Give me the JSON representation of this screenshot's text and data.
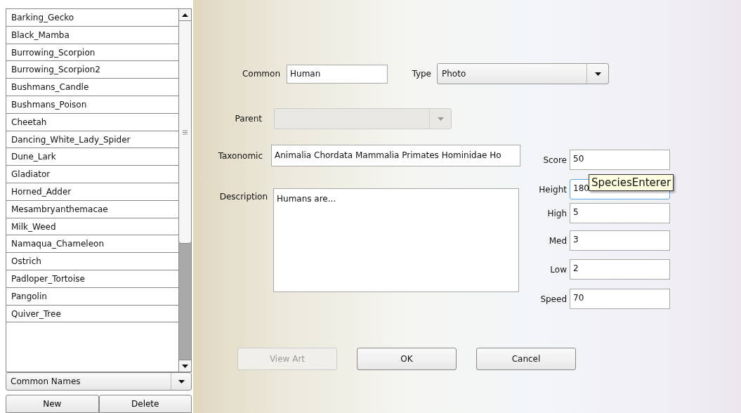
{
  "species_list": {
    "items": [
      "Barking_Gecko",
      "Black_Mamba",
      "Burrowing_Scorpion",
      "Burrowing_Scorpion2",
      "Bushmans_Candle",
      "Bushmans_Poison",
      "Cheetah",
      "Dancing_White_Lady_Spider",
      "Dune_Lark",
      "Gladiator",
      "Horned_Adder",
      "Mesambryanthemacae",
      "Milk_Weed",
      "Namaqua_Chameleon",
      "Ostrich",
      "Padloper_Tortoise",
      "Pangolin",
      "Quiver_Tree"
    ],
    "name_filter": "Common Names",
    "buttons": [
      "New",
      "Delete"
    ]
  },
  "form": {
    "common": {
      "label": "Common",
      "value": "Human"
    },
    "type": {
      "label": "Type",
      "value": "Photo"
    },
    "parent": {
      "label": "Parent",
      "disabled": true
    },
    "taxonomic": {
      "label": "Taxonomic",
      "value": "Animalia Chordata Mammalia Primates Hominidae Ho"
    },
    "description": {
      "label": "Description",
      "value": "Humans are..."
    },
    "stats": [
      {
        "label": "Score",
        "value": "50",
        "focused": false
      },
      {
        "label": "Height",
        "value": "180",
        "focused": true
      },
      {
        "label": "High",
        "value": "5",
        "focused": false
      },
      {
        "label": "Med",
        "value": "3",
        "focused": false
      },
      {
        "label": "Low",
        "value": "2",
        "focused": false
      },
      {
        "label": "Speed",
        "value": "70",
        "focused": false
      }
    ],
    "buttons": [
      {
        "label": "View Art",
        "disabled": true
      },
      {
        "label": "OK",
        "disabled": false
      },
      {
        "label": "Cancel",
        "disabled": false
      }
    ],
    "tooltip": "SpeciesEnterer"
  }
}
